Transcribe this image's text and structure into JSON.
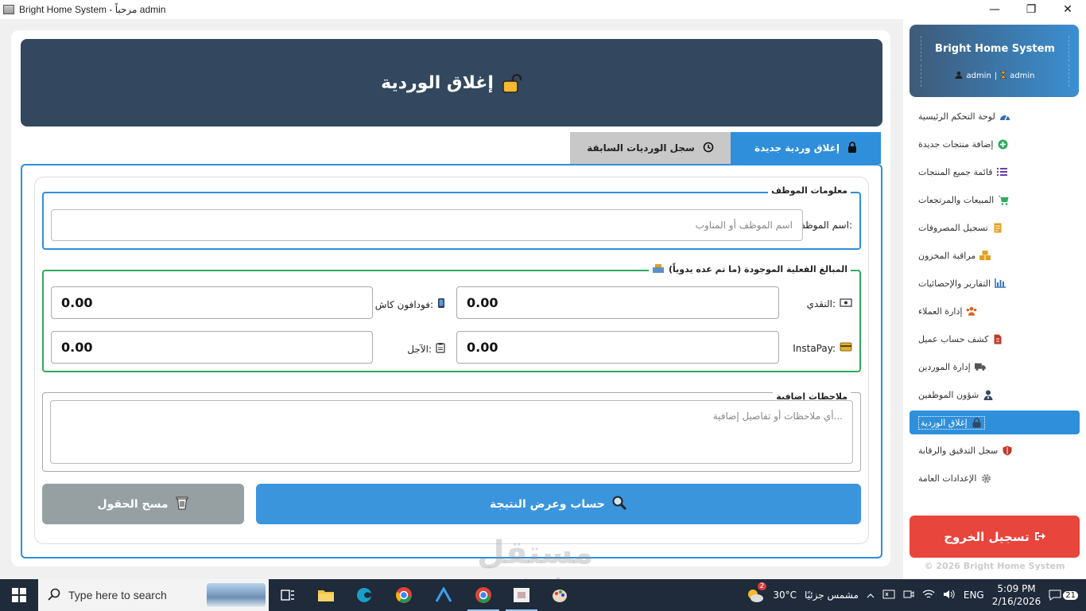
{
  "window": {
    "title": "Bright Home System - مرحباً admin",
    "min": "—",
    "max": "❐",
    "close": "✕"
  },
  "header": {
    "title": "إغلاق الوردية"
  },
  "tabs": [
    {
      "label": "إغلاق وردية جديدة",
      "icon": "lock-icon",
      "active": true
    },
    {
      "label": "سجل الورديات السابقة",
      "icon": "history-icon",
      "active": false
    }
  ],
  "employee_group": {
    "legend": "معلومات الموظف",
    "label": "اسم الموظف:",
    "placeholder": "اسم الموظف أو المناوب"
  },
  "amounts_group": {
    "legend": "المبالغ الفعلية الموجودة (ما تم عده يدوياً)",
    "cash_label": "النقدي:",
    "vodafone_label": "فودافون كاش:",
    "instapay_label": "InstaPay:",
    "credit_label": "الآجل:",
    "cash_value": "0.00",
    "vodafone_value": "0.00",
    "instapay_value": "0.00",
    "credit_value": "0.00"
  },
  "notes_group": {
    "legend": "ملاحظات إضافية",
    "placeholder": "أي ملاحظات أو تفاصيل إضافية..."
  },
  "buttons": {
    "calculate": "حساب وعرض النتيجة",
    "clear": "مسح الحقول"
  },
  "sidebar": {
    "brand": "Bright Home System",
    "user": "admin",
    "role": "admin",
    "separator": "|",
    "items": [
      {
        "label": "لوحة التحكم الرئيسية",
        "icon": "dashboard-icon",
        "color": "#2f6fb5"
      },
      {
        "label": "إضافة منتجات جديدة",
        "icon": "plus-circle-icon",
        "color": "#2eaa5c"
      },
      {
        "label": "قائمة جميع المنتجات",
        "icon": "list-icon",
        "color": "#6a3fa0"
      },
      {
        "label": "المبيعات والمرتجعات",
        "icon": "cart-icon",
        "color": "#2eaa5c"
      },
      {
        "label": "تسجيل المصروفات",
        "icon": "receipt-icon",
        "color": "#e0a020"
      },
      {
        "label": "مراقبة المخزون",
        "icon": "boxes-icon",
        "color": "#e0a020"
      },
      {
        "label": "التقارير والإحصائيات",
        "icon": "bar-chart-icon",
        "color": "#2f6fb5"
      },
      {
        "label": "إدارة العملاء",
        "icon": "users-icon",
        "color": "#e06020"
      },
      {
        "label": "كشف حساب عميل",
        "icon": "file-invoice-icon",
        "color": "#c0392b"
      },
      {
        "label": "إدارة الموردين",
        "icon": "truck-icon",
        "color": "#555555"
      },
      {
        "label": "شؤون الموظفين",
        "icon": "user-tie-icon",
        "color": "#33485f"
      },
      {
        "label": "إغلاق الوردية",
        "icon": "lock-icon",
        "color": "#33485f",
        "active": true
      },
      {
        "label": "سجل التدقيق والرقابة",
        "icon": "shield-icon",
        "color": "#c0392b"
      },
      {
        "label": "الإعدادات العامة",
        "icon": "gear-icon",
        "color": "#888888"
      }
    ],
    "logout": "تسجيل الخروج",
    "copyright": "© 2026 Bright Home System"
  },
  "watermark": {
    "line1": "مستقل",
    "line2": "mostaql.com"
  },
  "taskbar": {
    "search_placeholder": "Type here to search",
    "weather_temp": "30°C",
    "weather_text": "مشمس جزئيًا",
    "weather_badge": "2",
    "language": "ENG",
    "time": "5:09 PM",
    "date": "2/16/2026",
    "notifications": "21"
  }
}
